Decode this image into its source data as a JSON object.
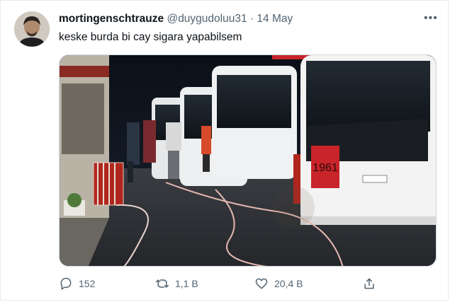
{
  "tweet": {
    "display_name": "mortingenschtrauze",
    "handle": "@duygudoluu31",
    "separator": "·",
    "date": "14 May",
    "text": "keske burda bi cay sigara yapabilsem",
    "more_icon": "more-horizontal-icon",
    "media": {
      "kind": "night photo of intercity buses parked at a bus terminal platform",
      "sign_text": "1961"
    },
    "actions": {
      "reply_count": "152",
      "retweet_count": "1,1 B",
      "like_count": "20,4 B",
      "reply_icon": "reply-icon",
      "retweet_icon": "retweet-icon",
      "like_icon": "heart-icon",
      "share_icon": "share-icon"
    }
  },
  "colors": {
    "text_primary": "#0f1419",
    "text_secondary": "#536471",
    "border": "#e6ecf0"
  }
}
